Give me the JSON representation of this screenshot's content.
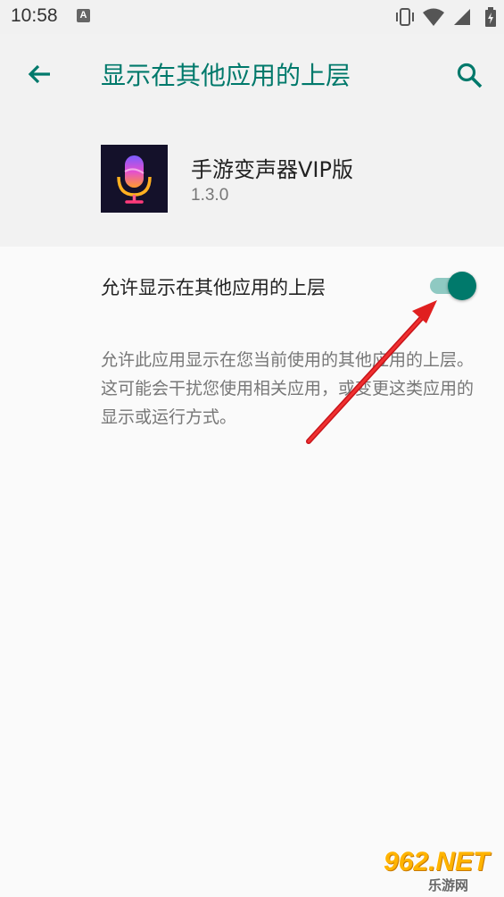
{
  "status_bar": {
    "time": "10:58",
    "notification_icon": "A",
    "icons": [
      "vibrate-icon",
      "wifi-icon",
      "signal-icon",
      "battery-icon"
    ]
  },
  "header": {
    "title": "显示在其他应用的上层",
    "back_icon": "arrow-back-icon",
    "search_icon": "search-icon"
  },
  "app": {
    "name": "手游变声器VIP版",
    "version": "1.3.0",
    "icon": "microphone-icon"
  },
  "setting": {
    "label": "允许显示在其他应用的上层",
    "enabled": true,
    "description": "允许此应用显示在您当前使用的其他应用的上层。这可能会干扰您使用相关应用，或变更这类应用的显示或运行方式。"
  },
  "watermark": {
    "main": "962.NET",
    "sub": "乐游网"
  },
  "colors": {
    "accent": "#00796b",
    "annotation_arrow": "#e02020"
  }
}
